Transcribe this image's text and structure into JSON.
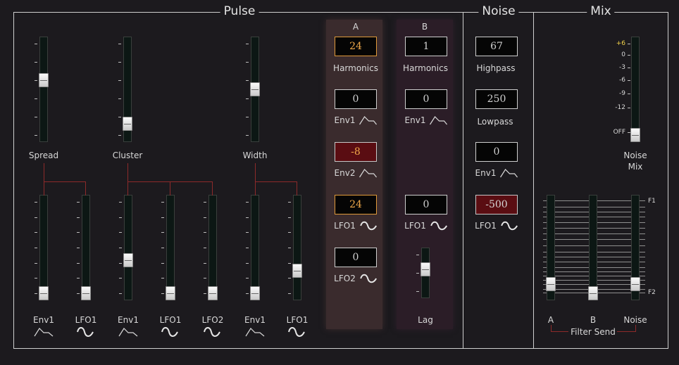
{
  "sections": {
    "pulse": "Pulse",
    "noise": "Noise",
    "mix": "Mix"
  },
  "pulse": {
    "sliders": [
      {
        "label": "Spread",
        "value": 0.6
      },
      {
        "label": "Cluster",
        "value": 0.12
      },
      {
        "label": "Width",
        "value": 0.5
      }
    ],
    "mod_sliders": [
      {
        "label": "Env1",
        "icon": "envelope-icon",
        "value": 0.0
      },
      {
        "label": "LFO1",
        "icon": "sine-wave-icon",
        "value": 0.0
      },
      {
        "label": "Env1",
        "icon": "envelope-icon",
        "value": 0.36
      },
      {
        "label": "LFO1",
        "icon": "sine-wave-icon",
        "value": 0.0
      },
      {
        "label": "LFO2",
        "icon": "sine-wave-icon",
        "value": 0.0
      },
      {
        "label": "Env1",
        "icon": "envelope-icon",
        "value": 0.0
      },
      {
        "label": "LFO1",
        "icon": "sine-wave-icon",
        "value": 0.25
      }
    ]
  },
  "col_a": {
    "header": "A",
    "harmonics": {
      "value": "24",
      "label": "Harmonics"
    },
    "env1": {
      "value": "0",
      "label": "Env1"
    },
    "env2": {
      "value": "-8",
      "label": "Env2"
    },
    "lfo1": {
      "value": "24",
      "label": "LFO1"
    },
    "lfo2": {
      "value": "0",
      "label": "LFO2"
    }
  },
  "col_b": {
    "header": "B",
    "harmonics": {
      "value": "1",
      "label": "Harmonics"
    },
    "env1": {
      "value": "0",
      "label": "Env1"
    },
    "lfo1": {
      "value": "0",
      "label": "LFO1"
    },
    "lag": {
      "label": "Lag",
      "value": 0.6
    }
  },
  "noise": {
    "highpass": {
      "value": "67",
      "label": "Highpass"
    },
    "lowpass": {
      "value": "250",
      "label": "Lowpass"
    },
    "env1": {
      "value": "0",
      "label": "Env1"
    },
    "lfo1": {
      "value": "-500",
      "label": "LFO1"
    }
  },
  "mix": {
    "noise_mix": {
      "label_line1": "Noise",
      "label_line2": "Mix",
      "value": 0.0
    },
    "db_ticks": [
      "+6",
      "0",
      "-3",
      "-6",
      "-9",
      "-12",
      "OFF"
    ],
    "db_tick_colors": {
      "highlight": "#f2d24a",
      "normal": "#d8d8d8"
    },
    "filter_markers": {
      "top": "F1",
      "bottom": "F2"
    },
    "filter_send": {
      "title": "Filter Send",
      "sliders": [
        {
          "label": "A",
          "value": 0.1
        },
        {
          "label": "B",
          "value": 0.0
        },
        {
          "label": "Noise",
          "value": 0.1
        }
      ]
    }
  },
  "colors": {
    "accent": "#f0a94a",
    "wire": "#8d2a2a",
    "panel_a": "#3a2b2d",
    "panel_b": "#2b1d27"
  }
}
